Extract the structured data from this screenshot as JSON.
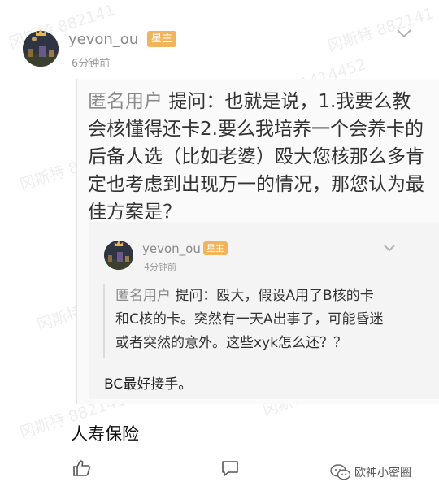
{
  "comment": {
    "username": "yevon_ou",
    "badge": "星主",
    "time": "6分钟前",
    "text": "人寿保险"
  },
  "quoted_question": {
    "author": "匿名用户",
    "prefix": "提问：",
    "text": "也就是说，1.我要么教会核懂得还卡2.要么我培养一个会养卡的后备人选（比如老婆）殴大您核那么多肯定也考虑到出现万一的情况，那您认为最佳方案是？"
  },
  "nested_answer": {
    "username": "yevon_ou",
    "badge": "星主",
    "time": "4分钟前",
    "question_author": "匿名用户",
    "question_prefix": "提问：",
    "question_text": "殴大，假设A用了B核的卡和C核的卡。突然有一天A出事了，可能昏迷或者突然的意外。这些xyk怎么还？？",
    "reply": "BC最好接手。"
  },
  "watermarks": [
    "冈斯特 882141",
    "冈斯特 882141",
    "冈斯特 8821414452",
    "冈斯特 8821414452",
    "冈斯特 8821414452",
    "冈斯特 88214144522882",
    "冈斯特 8821414452",
    "冈斯特 882141"
  ],
  "footer": {
    "share_label": "欧神小密圈"
  },
  "icons": {
    "like": "thumbs-up-icon",
    "comment": "comment-icon",
    "share": "wechat-icon",
    "more": "chevron-down-icon"
  },
  "colors": {
    "badge": "#f2b45b",
    "crown": "#e8b64c"
  }
}
